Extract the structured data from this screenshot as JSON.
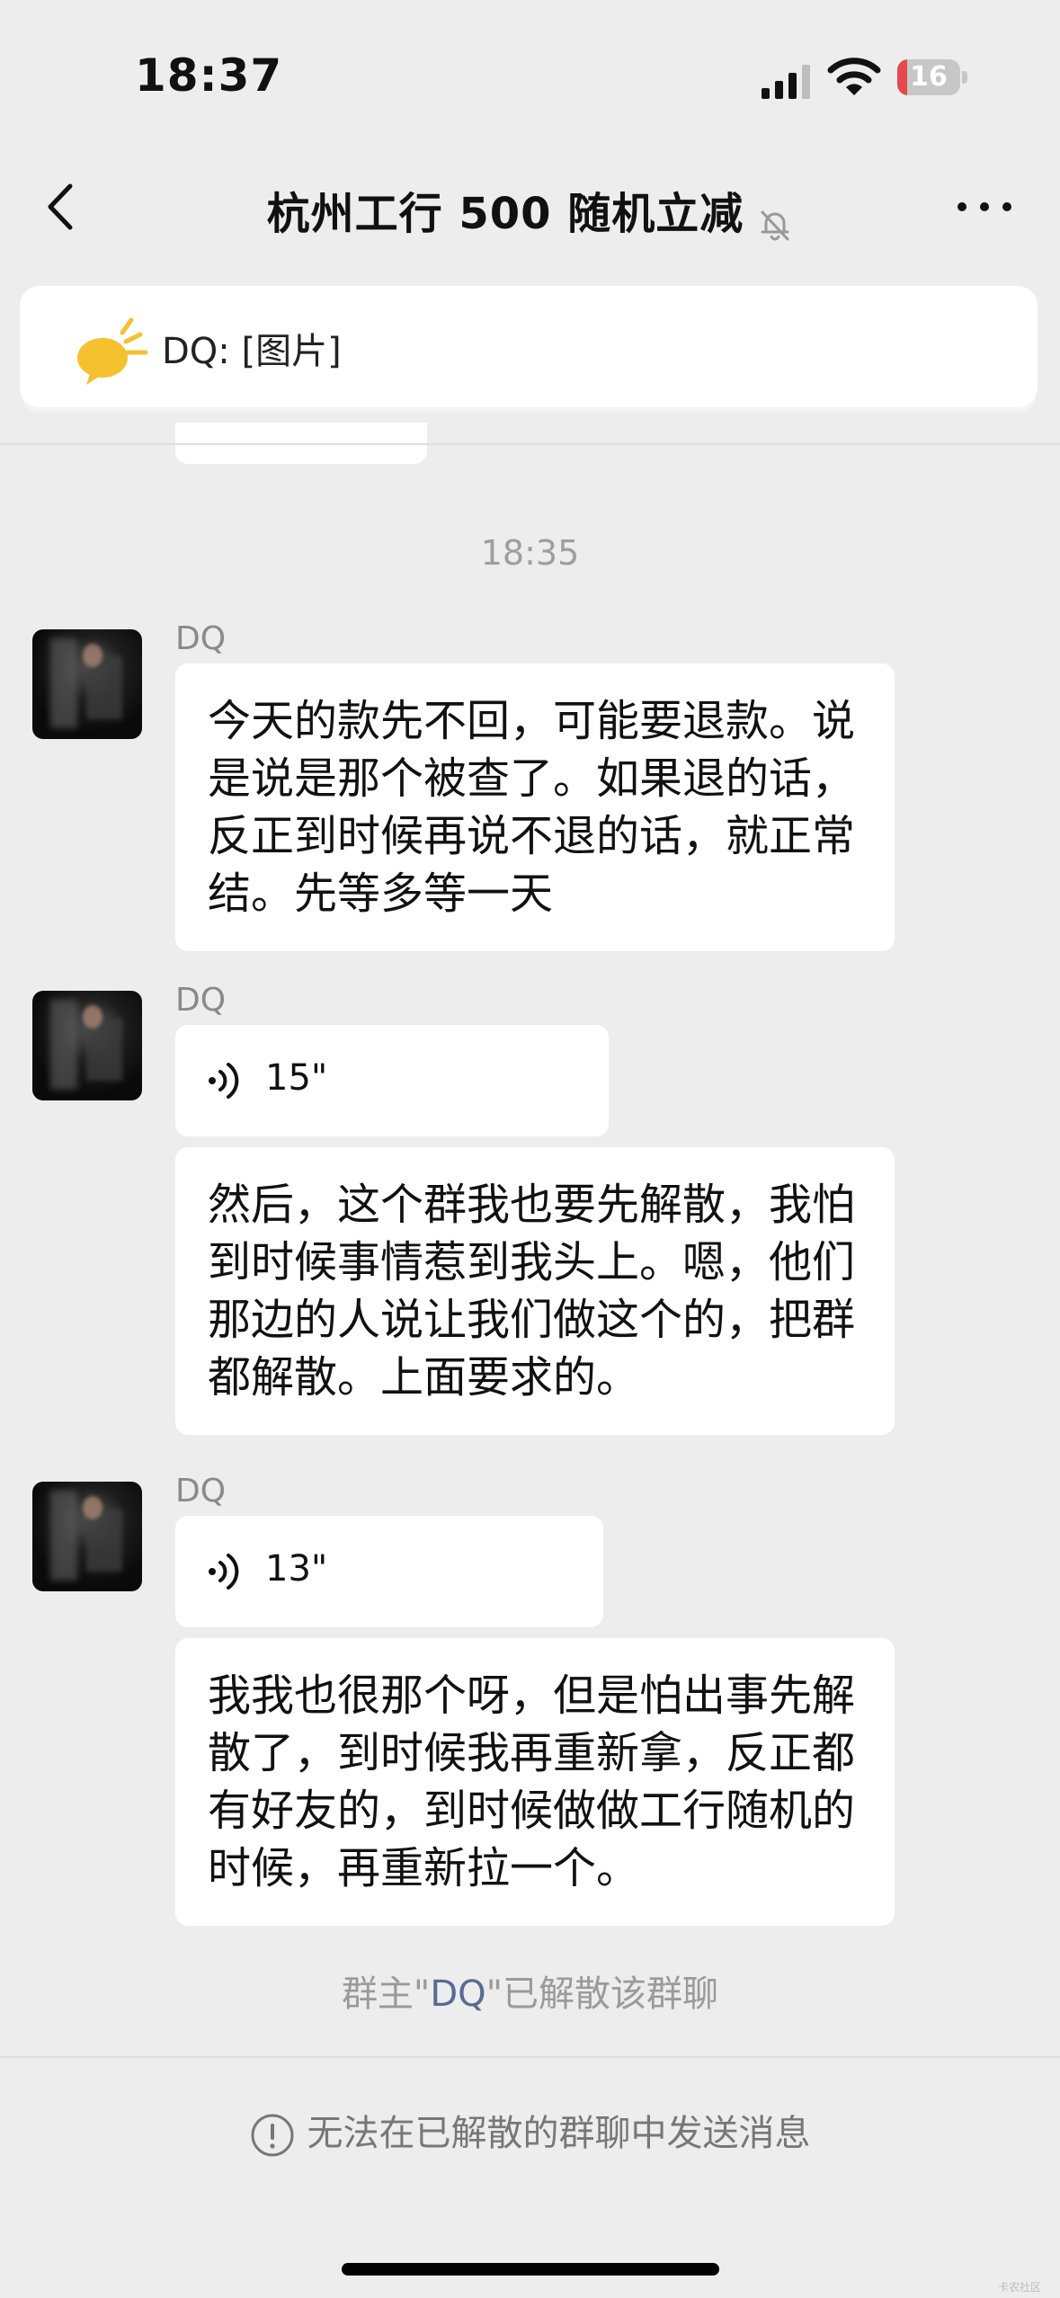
{
  "status_bar": {
    "time": "18:37",
    "battery": "16",
    "battery_level": 0.16
  },
  "chat": {
    "title": "杭州工行 500 随机立减"
  },
  "pinned": {
    "text": "DQ: [图片]"
  },
  "timestamp": "18:35",
  "messages": [
    {
      "sender": "DQ",
      "text": "今天的款先不回，可能要退款。说是说是那个被查了。如果退的话，反正到时候再说不退的话，就正常结。先等多等一天"
    },
    {
      "sender": "DQ",
      "voice_duration": "15\"",
      "text": "然后，这个群我也要先解散，我怕到时候事情惹到我头上。嗯，他们那边的人说让我们做这个的，把群都解散。上面要求的。"
    },
    {
      "sender": "DQ",
      "voice_duration": "13\"",
      "text": "我我也很那个呀，但是怕出事先解散了，到时候我再重新拿，反正都有好友的，到时候做做工行随机的时候，再重新拉一个。"
    }
  ],
  "system_note": {
    "prefix": "群主\"",
    "name": "DQ",
    "suffix": "\"已解散该群聊"
  },
  "footer": {
    "notice": "无法在已解散的群聊中发送消息"
  },
  "colors": {
    "link": "#576b95",
    "battery_low": "#e5484d",
    "background": "#ededed"
  },
  "watermark": "卡农社区"
}
